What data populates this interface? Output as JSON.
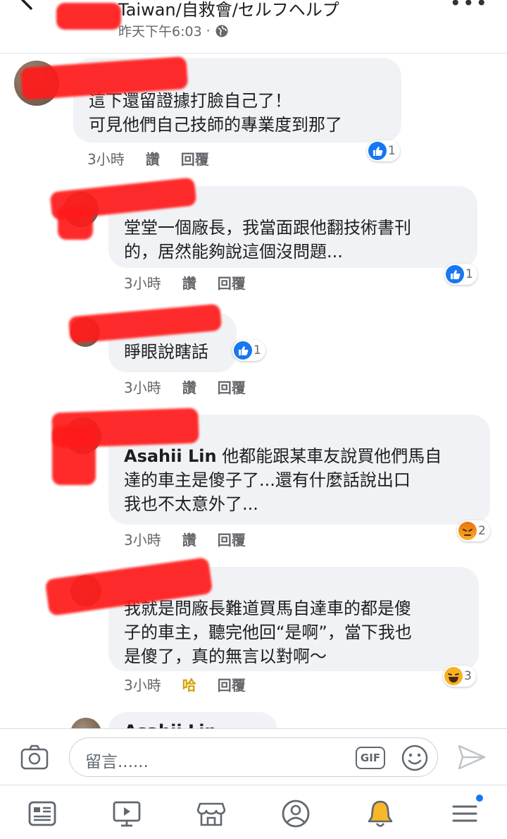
{
  "header": {
    "title": "Taiwan/自救會/セルフヘルプ",
    "timestamp": "昨天下午6:03",
    "separator": "·"
  },
  "comments": [
    {
      "text": "這下還留證據打臉自己了！\n可見他們自己技師的專業度到那了",
      "time": "3小時",
      "like": "讚",
      "reply": "回覆",
      "reaction": "like",
      "reaction_count": "1"
    },
    {
      "text": "堂堂一個廠長，我當面跟他翻技術書刊\n的，居然能夠說這個沒問題...",
      "time": "3小時",
      "like": "讚",
      "reply": "回覆",
      "reaction": "like",
      "reaction_count": "1"
    },
    {
      "text": "睜眼說瞎話",
      "time": "3小時",
      "like": "讚",
      "reply": "回覆",
      "reaction": "like",
      "reaction_count": "1"
    },
    {
      "author": "Asahii Lin",
      "text": " 他都能跟某車友說買他們馬自\n達的車主是傻子了...還有什麼話說出口\n我也不太意外了...",
      "time": "3小時",
      "like": "讚",
      "reply": "回覆",
      "reaction": "angry",
      "reaction_count": "2"
    },
    {
      "text": "我就是問廠長難道買馬自達車的都是傻\n子的車主，聽完他回“是啊”，當下我也\n是傻了，真的無言以對啊～",
      "time": "3小時",
      "like": "哈",
      "reply": "回覆",
      "reaction": "haha",
      "reaction_count": "3"
    },
    {
      "author": "Asahii Lin"
    }
  ],
  "composer": {
    "placeholder": "留言......",
    "gif_label": "GIF"
  },
  "tabbar": [
    "news-feed-icon",
    "watch-icon",
    "marketplace-icon",
    "profile-icon",
    "notifications-icon",
    "menu-icon"
  ],
  "colors": {
    "accent": "#1877f2",
    "bubble": "#f0f2f5",
    "haha": "#d4a106",
    "redaction": "#ff1a1a"
  }
}
